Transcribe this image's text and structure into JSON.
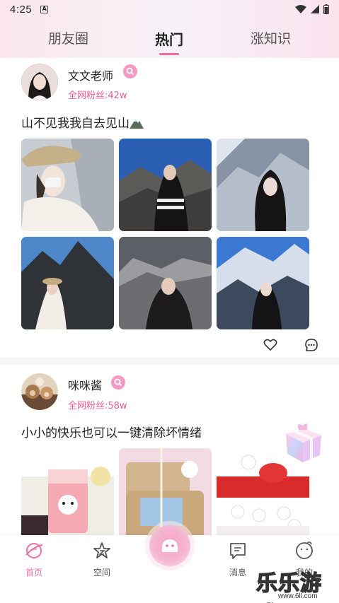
{
  "status_bar": {
    "time": "4:25",
    "notification_icon": "A"
  },
  "tabs": [
    {
      "label": "朋友圈"
    },
    {
      "label": "热门"
    },
    {
      "label": "涨知识"
    }
  ],
  "posts": [
    {
      "username": "文文老师",
      "fans": "全网粉丝:42w",
      "text": "山不见我我自去见山",
      "emoji": "mountain-emoji"
    },
    {
      "username": "咪咪酱",
      "fans": "全网粉丝:58w",
      "text": "小小的快乐也可以一键清除坏情绪"
    }
  ],
  "bottom_nav": [
    {
      "label": "首页",
      "icon": "home-planet-icon",
      "active": true
    },
    {
      "label": "空间",
      "icon": "star-space-icon"
    },
    {
      "label": "",
      "icon": "center-face-icon"
    },
    {
      "label": "消息",
      "icon": "message-icon"
    },
    {
      "label": "我的",
      "icon": "profile-face-icon"
    }
  ],
  "watermark": {
    "main": "乐乐游戏",
    "sub": "www.6ll.com"
  },
  "colors": {
    "accent": "#f06fa3",
    "badge": "#f49ac4",
    "fans_text": "#e85f97"
  }
}
